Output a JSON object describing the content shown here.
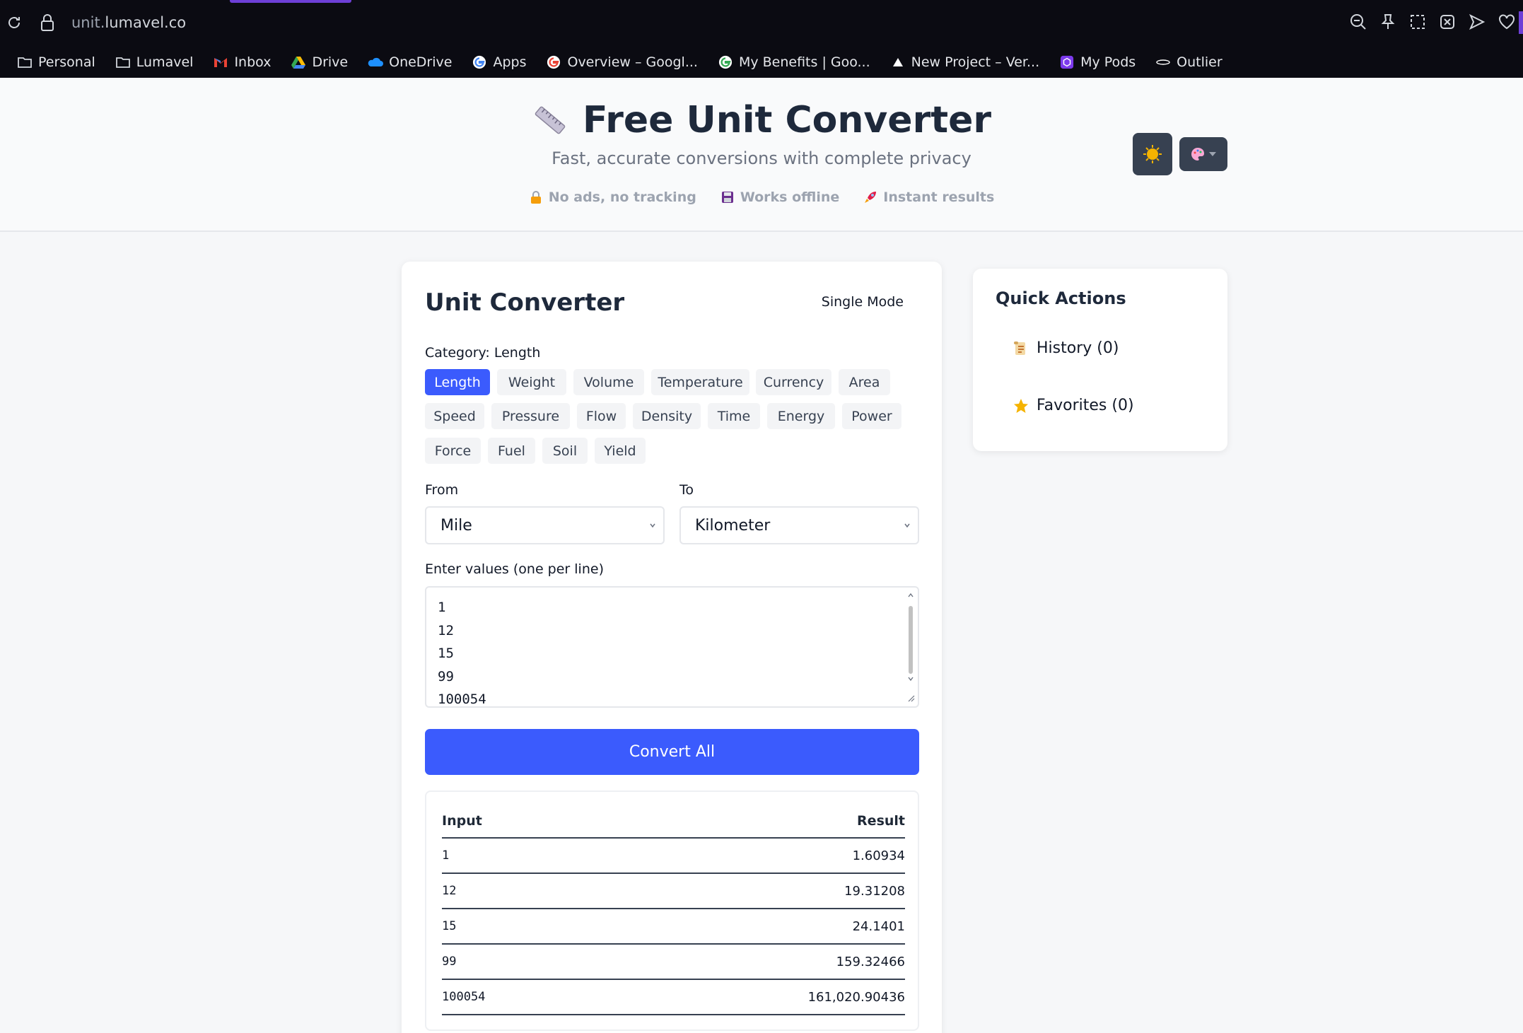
{
  "browser": {
    "url_prefix": "unit.",
    "url_host": "lumavel.co",
    "bookmarks": [
      {
        "label": "Personal",
        "icon": "folder-icon"
      },
      {
        "label": "Lumavel",
        "icon": "folder-icon"
      },
      {
        "label": "Inbox",
        "icon": "gmail-icon"
      },
      {
        "label": "Drive",
        "icon": "drive-icon"
      },
      {
        "label": "OneDrive",
        "icon": "onedrive-icon"
      },
      {
        "label": "Apps",
        "icon": "google-icon"
      },
      {
        "label": "Overview – Googl...",
        "icon": "google-icon"
      },
      {
        "label": "My Benefits | Goo...",
        "icon": "google-icon"
      },
      {
        "label": "New Project – Ver...",
        "icon": "vercel-icon"
      },
      {
        "label": "My Pods",
        "icon": "pods-icon"
      },
      {
        "label": "Outlier",
        "icon": "outlier-icon"
      }
    ]
  },
  "header": {
    "title": "Free Unit Converter",
    "subtitle": "Fast, accurate conversions with complete privacy",
    "badges": [
      {
        "label": "No ads, no tracking",
        "icon": "lock-icon"
      },
      {
        "label": "Works offline",
        "icon": "floppy-icon"
      },
      {
        "label": "Instant results",
        "icon": "rocket-icon"
      }
    ]
  },
  "converter": {
    "title": "Unit Converter",
    "mode": "Single Mode",
    "category_label": "Category: Length",
    "categories": [
      "Length",
      "Weight",
      "Volume",
      "Temperature",
      "Currency",
      "Area",
      "Speed",
      "Pressure",
      "Flow",
      "Density",
      "Time",
      "Energy",
      "Power",
      "Force",
      "Fuel",
      "Soil",
      "Yield"
    ],
    "active_category": "Length",
    "from_label": "From",
    "to_label": "To",
    "from_value": "Mile",
    "to_value": "Kilometer",
    "values_label": "Enter values (one per line)",
    "values": [
      "1",
      "12",
      "15",
      "99",
      "100054"
    ],
    "convert_label": "Convert All",
    "results": {
      "header_input": "Input",
      "header_result": "Result",
      "rows": [
        {
          "input": "1",
          "result": "1.60934"
        },
        {
          "input": "12",
          "result": "19.31208"
        },
        {
          "input": "15",
          "result": "24.1401"
        },
        {
          "input": "99",
          "result": "159.32466"
        },
        {
          "input": "100054",
          "result": "161,020.90436"
        }
      ]
    }
  },
  "quick_actions": {
    "title": "Quick Actions",
    "history": "History (0)",
    "favorites": "Favorites (0)"
  },
  "colors": {
    "accent": "#3b5bfd",
    "chrome_bg": "#0b0b12",
    "tab_indicator": "#6d3fd6"
  }
}
